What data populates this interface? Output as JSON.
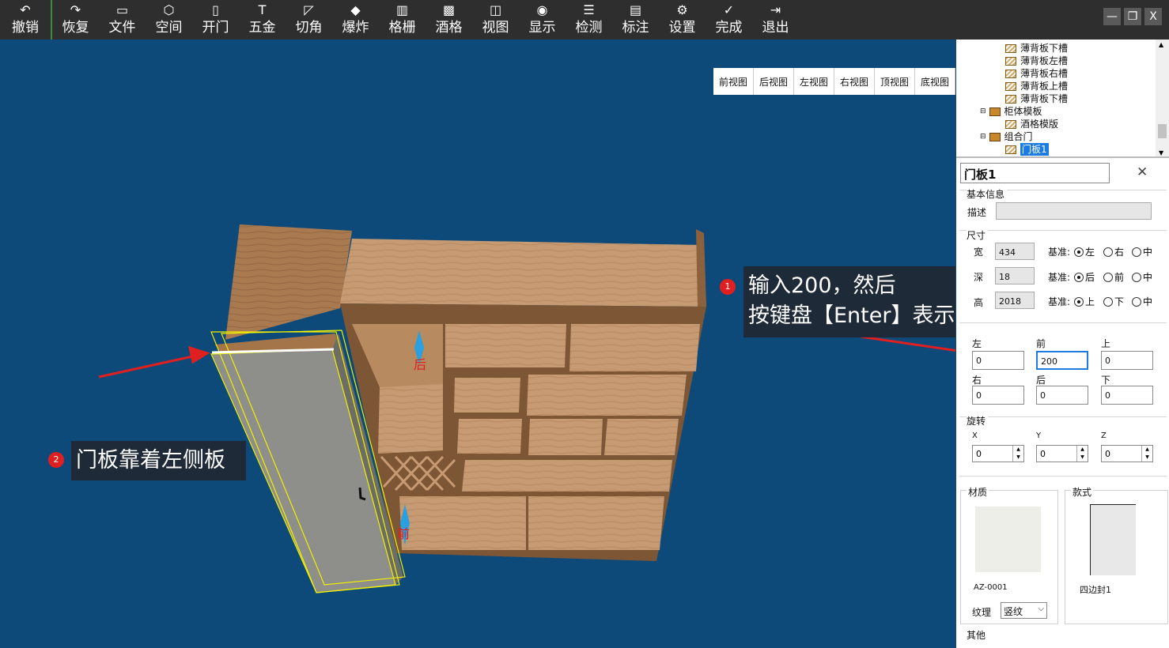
{
  "toolbar": {
    "buttons": [
      {
        "label": "撤销",
        "icon": "↶"
      },
      {
        "label": "恢复",
        "icon": "↷"
      },
      {
        "label": "文件",
        "icon": "▭"
      },
      {
        "label": "空间",
        "icon": "⬡"
      },
      {
        "label": "开门",
        "icon": "▯"
      },
      {
        "label": "五金",
        "icon": "T"
      },
      {
        "label": "切角",
        "icon": "◸"
      },
      {
        "label": "爆炸",
        "icon": "◆"
      },
      {
        "label": "格栅",
        "icon": "▥"
      },
      {
        "label": "酒格",
        "icon": "▩"
      },
      {
        "label": "视图",
        "icon": "◫"
      },
      {
        "label": "显示",
        "icon": "◉"
      },
      {
        "label": "检测",
        "icon": "☰"
      },
      {
        "label": "标注",
        "icon": "▤"
      },
      {
        "label": "设置",
        "icon": "⚙"
      },
      {
        "label": "完成",
        "icon": "✓"
      },
      {
        "label": "退出",
        "icon": "⇥"
      }
    ],
    "window_controls": {
      "minimize": "—",
      "restore": "❐",
      "close": "X"
    }
  },
  "viewport": {
    "view_tabs": [
      "前视图",
      "后视图",
      "左视图",
      "右视图",
      "顶视图",
      "底视图"
    ],
    "callout1": {
      "badge": "1",
      "line1": "输入200，然后",
      "line2": "按键盘【Enter】表示确定"
    },
    "callout2": {
      "badge": "2",
      "text": "门板靠着左侧板"
    },
    "direction_labels": {
      "back": "后",
      "front": "前"
    }
  },
  "tree": {
    "items": [
      {
        "label": "薄背板下槽",
        "type": "board"
      },
      {
        "label": "薄背板左槽",
        "type": "board"
      },
      {
        "label": "薄背板右槽",
        "type": "board"
      },
      {
        "label": "薄背板上槽",
        "type": "board"
      },
      {
        "label": "薄背板下槽",
        "type": "board"
      },
      {
        "label": "柜体模板",
        "type": "folder"
      },
      {
        "label": "酒格模版",
        "type": "board"
      },
      {
        "label": "组合门",
        "type": "folder"
      },
      {
        "label": "门板1",
        "type": "board",
        "selected": true
      }
    ]
  },
  "props": {
    "title": "门板1",
    "close": "✕",
    "basic_info": "基本信息",
    "desc_label": "描述",
    "desc_value": "",
    "size_title": "尺寸",
    "size_rows": [
      {
        "label": "宽",
        "value": "434",
        "ref_label": "基准:",
        "options": [
          "左",
          "右",
          "中"
        ],
        "selected": 0
      },
      {
        "label": "深",
        "value": "18",
        "ref_label": "基准:",
        "options": [
          "后",
          "前",
          "中"
        ],
        "selected": 0
      },
      {
        "label": "高",
        "value": "2018",
        "ref_label": "基准:",
        "options": [
          "上",
          "下",
          "中"
        ],
        "selected": 0
      }
    ],
    "offset": {
      "left": {
        "label": "左",
        "value": "0"
      },
      "front": {
        "label": "前",
        "value": "200"
      },
      "top": {
        "label": "上",
        "value": "0"
      },
      "right": {
        "label": "右",
        "value": "0"
      },
      "back": {
        "label": "后",
        "value": "0"
      },
      "bottom": {
        "label": "下",
        "value": "0"
      }
    },
    "rotate_title": "旋转",
    "rotate": [
      {
        "axis": "X",
        "value": "0"
      },
      {
        "axis": "Y",
        "value": "0"
      },
      {
        "axis": "Z",
        "value": "0"
      }
    ],
    "material_title": "材质",
    "material_code": "AZ-0001",
    "style_title": "款式",
    "style_name": "四边封1",
    "texture_label": "纹理",
    "texture_value": "竖纹",
    "other_title": "其他"
  }
}
